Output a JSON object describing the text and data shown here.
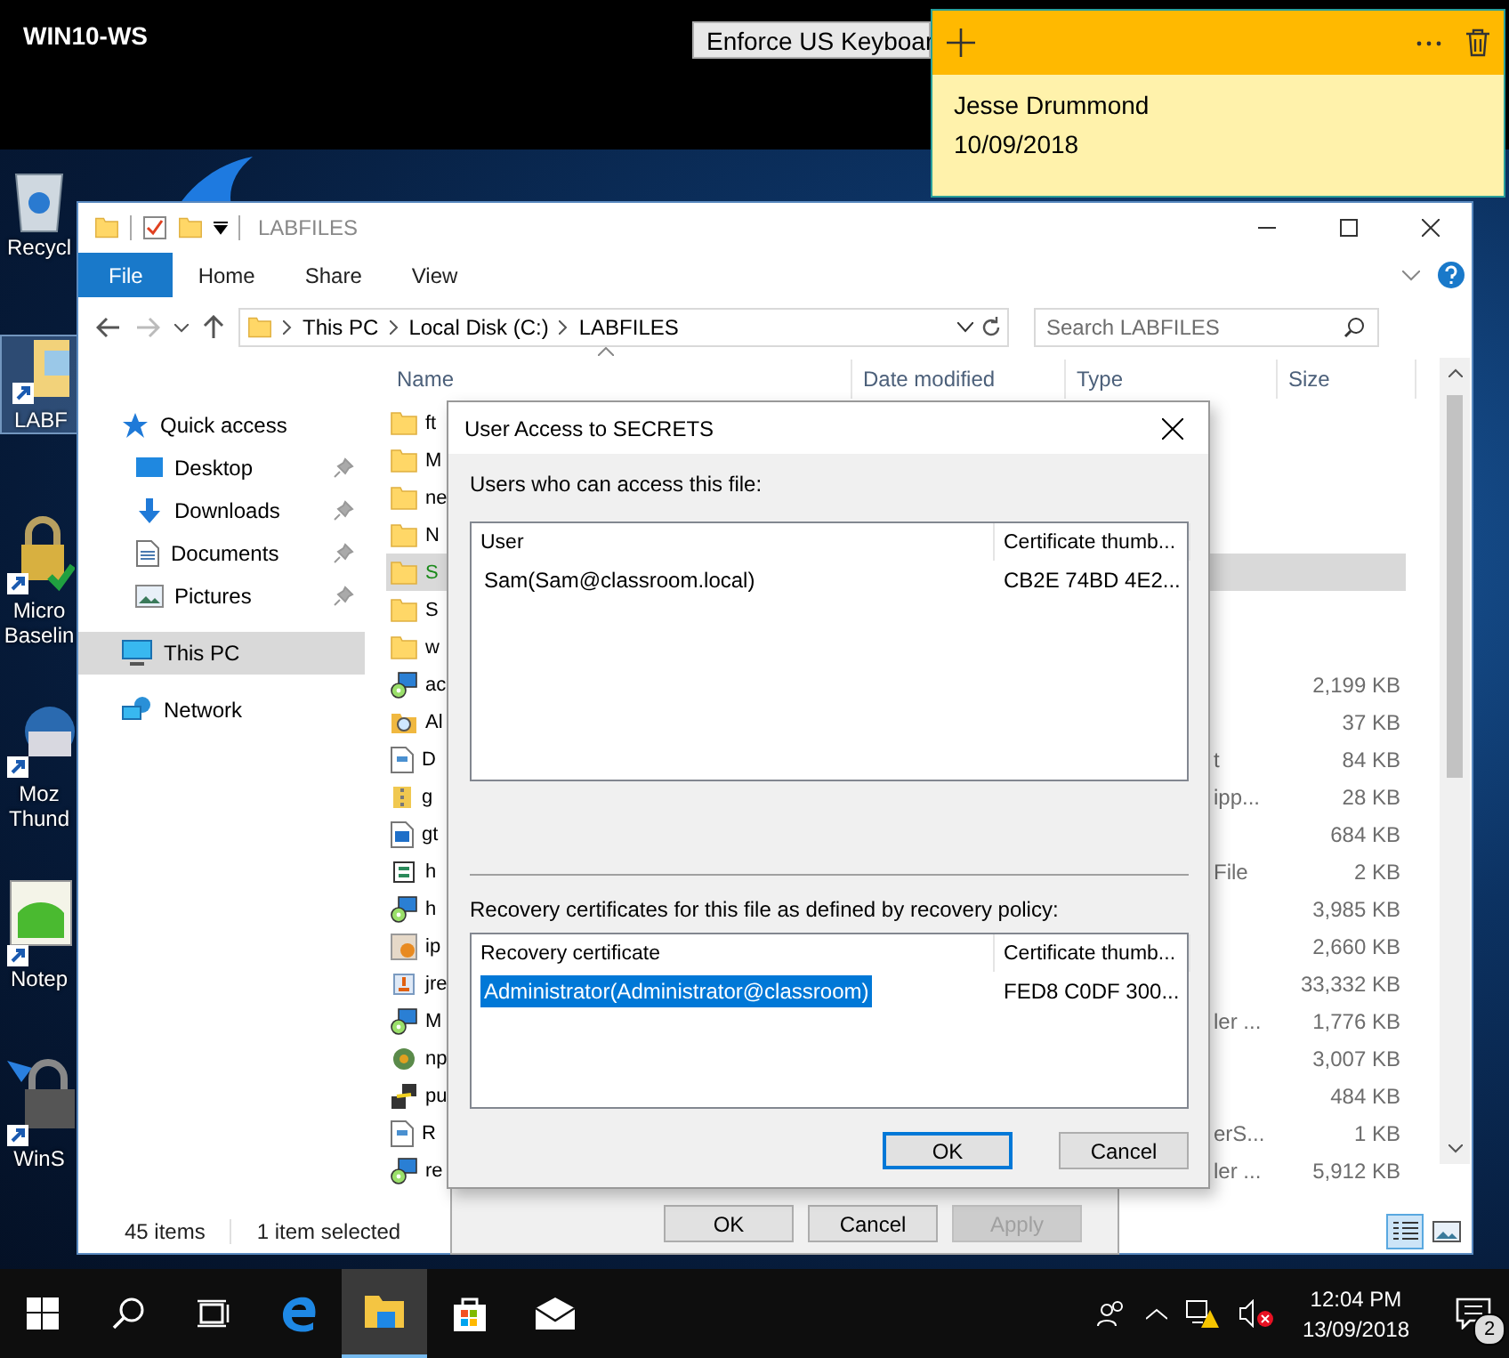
{
  "top_bar": {
    "machine": "WIN10-WS",
    "button": "Enforce US Keyboar"
  },
  "sticky_note": {
    "lines": [
      "Jesse Drummond",
      "10/09/2018"
    ]
  },
  "desktop_icons": [
    {
      "label": "Recycl",
      "kind": "recycle",
      "selected": false
    },
    {
      "label": "LABF",
      "kind": "folder",
      "selected": true
    },
    {
      "label": "Micro\nBaselin",
      "kind": "lock",
      "selected": false
    },
    {
      "label": "Moz\nThund",
      "kind": "mail",
      "selected": false
    },
    {
      "label": "Notep",
      "kind": "notepad",
      "selected": false
    },
    {
      "label": "WinS",
      "kind": "padlock",
      "selected": false
    }
  ],
  "explorer": {
    "title": "LABFILES",
    "ribbon_tabs": [
      {
        "label": "File",
        "kind": "file"
      },
      {
        "label": "Home",
        "kind": "tab"
      },
      {
        "label": "Share",
        "kind": "tab"
      },
      {
        "label": "View",
        "kind": "tab"
      }
    ],
    "path": [
      "This PC",
      "Local Disk (C:)",
      "LABFILES"
    ],
    "search": {
      "placeholder": "Search LABFILES"
    },
    "sidebar": [
      {
        "label": "Quick access",
        "kind": "star",
        "selected": false,
        "children": [
          {
            "label": "Desktop",
            "kind": "desktop",
            "selected": false,
            "pinned": true
          },
          {
            "label": "Downloads",
            "kind": "download",
            "selected": false,
            "pinned": true
          },
          {
            "label": "Documents",
            "kind": "document",
            "selected": false,
            "pinned": true
          },
          {
            "label": "Pictures",
            "kind": "pictures",
            "selected": false,
            "pinned": true
          }
        ]
      },
      {
        "label": "This PC",
        "kind": "pc",
        "selected": true
      },
      {
        "label": "Network",
        "kind": "network",
        "selected": false
      }
    ],
    "columns": [
      "Name",
      "Date modified",
      "Type",
      "Size"
    ],
    "files": [
      {
        "name": "ft",
        "kind": "folder",
        "selected": false,
        "encrypted": false
      },
      {
        "name": "M",
        "kind": "folder",
        "selected": false,
        "encrypted": false
      },
      {
        "name": "ne",
        "kind": "folder",
        "selected": false,
        "encrypted": false
      },
      {
        "name": "N",
        "kind": "folder",
        "selected": false,
        "encrypted": false
      },
      {
        "name": "S",
        "kind": "folder",
        "selected": true,
        "encrypted": true
      },
      {
        "name": "S",
        "kind": "folder",
        "selected": false,
        "encrypted": false
      },
      {
        "name": "w",
        "kind": "folder",
        "selected": false,
        "encrypted": false
      },
      {
        "name": "ac",
        "kind": "installer",
        "selected": false,
        "encrypted": false,
        "size": "2,199 KB"
      },
      {
        "name": "Al",
        "kind": "search-folder",
        "selected": false,
        "encrypted": false,
        "size": "37 KB"
      },
      {
        "name": "D",
        "kind": "document",
        "selected": false,
        "encrypted": false,
        "type": "t",
        "size": "84 KB"
      },
      {
        "name": "g",
        "kind": "zip",
        "selected": false,
        "encrypted": false,
        "type": "ipp...",
        "size": "28 KB"
      },
      {
        "name": "gt",
        "kind": "image",
        "selected": false,
        "encrypted": false,
        "size": "684 KB"
      },
      {
        "name": "h",
        "kind": "script",
        "selected": false,
        "encrypted": false,
        "type": "File",
        "size": "2 KB"
      },
      {
        "name": "h",
        "kind": "installer",
        "selected": false,
        "encrypted": false,
        "size": "3,985 KB"
      },
      {
        "name": "ip",
        "kind": "package",
        "selected": false,
        "encrypted": false,
        "size": "2,660 KB"
      },
      {
        "name": "jre",
        "kind": "java",
        "selected": false,
        "encrypted": false,
        "size": "33,332 KB"
      },
      {
        "name": "M",
        "kind": "installer",
        "selected": false,
        "encrypted": false,
        "type": "ler ...",
        "size": "1,776 KB"
      },
      {
        "name": "np",
        "kind": "gear",
        "selected": false,
        "encrypted": false,
        "size": "3,007 KB"
      },
      {
        "name": "pu",
        "kind": "terminal",
        "selected": false,
        "encrypted": false,
        "size": "484 KB"
      },
      {
        "name": "R",
        "kind": "document",
        "selected": false,
        "encrypted": false,
        "type": "erS...",
        "size": "1 KB"
      },
      {
        "name": "re",
        "kind": "installer",
        "selected": false,
        "encrypted": false,
        "type": "ler ...",
        "size": "5,912 KB"
      }
    ],
    "status": [
      "45 items",
      "1 item selected"
    ]
  },
  "properties_buttons": [
    {
      "label": "OK",
      "disabled": false
    },
    {
      "label": "Cancel",
      "disabled": false
    },
    {
      "label": "Apply",
      "disabled": true
    }
  ],
  "dialog": {
    "title": "User Access to SECRETS",
    "users_label": "Users who can access this file:",
    "users_columns": [
      "User",
      "Certificate thumb..."
    ],
    "users_rows": [
      {
        "cells": [
          "Sam(Sam@classroom.local)",
          "CB2E 74BD 4E2..."
        ],
        "selected": false
      }
    ],
    "recovery_label": "Recovery certificates for this file as defined by recovery policy:",
    "recovery_columns": [
      "Recovery certificate",
      "Certificate thumb..."
    ],
    "recovery_rows": [
      {
        "cells": [
          "Administrator(Administrator@classroom)",
          "FED8 C0DF 300..."
        ],
        "selected": true
      }
    ],
    "buttons": [
      {
        "label": "OK",
        "default": true
      },
      {
        "label": "Cancel",
        "default": false
      }
    ]
  },
  "taskbar": {
    "apps": [
      {
        "kind": "search",
        "active": false
      },
      {
        "kind": "taskview",
        "active": false
      },
      {
        "kind": "edge",
        "active": false
      },
      {
        "kind": "explorer",
        "active": true
      },
      {
        "kind": "store",
        "active": false
      },
      {
        "kind": "mail",
        "active": false
      }
    ],
    "time": "12:04 PM",
    "date": "13/09/2018",
    "notifications": "2"
  }
}
